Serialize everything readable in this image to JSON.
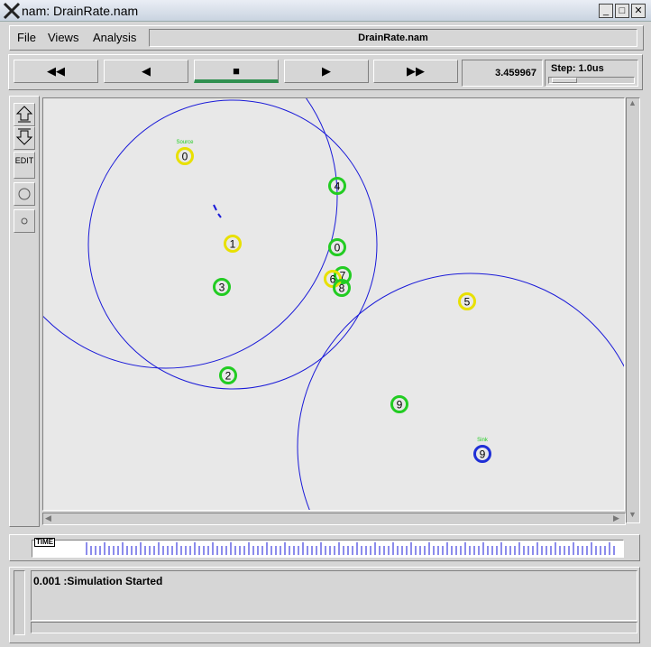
{
  "window": {
    "title": "nam: DrainRate.nam",
    "min_glyph": "_",
    "max_glyph": "□",
    "close_glyph": "✕"
  },
  "menu": {
    "file": "File",
    "views": "Views",
    "analysis": "Analysis",
    "filename": "DrainRate.nam"
  },
  "toolbar": {
    "rewind": "◀◀",
    "back": "◀",
    "stop": "■",
    "play": "▶",
    "fastforward": "▶▶",
    "time": "3.459967",
    "step": "Step: 1.0us"
  },
  "tools": {
    "edit": "EDIT"
  },
  "nodes": [
    {
      "id": "0",
      "color": "#e8e000",
      "label": "Source"
    },
    {
      "id": "1",
      "color": "#e8e000"
    },
    {
      "id": "4",
      "color": "#22cc22"
    },
    {
      "id": "0",
      "color": "#22cc22"
    },
    {
      "id": "7",
      "color": "#22cc22"
    },
    {
      "id": "6",
      "color": "#e8e000"
    },
    {
      "id": "8",
      "color": "#22cc22"
    },
    {
      "id": "3",
      "color": "#22cc22"
    },
    {
      "id": "2",
      "color": "#22cc22"
    },
    {
      "id": "5",
      "color": "#e8e000"
    },
    {
      "id": "9",
      "color": "#22cc22"
    },
    {
      "id": "9",
      "color": "#1f2fd6",
      "label": "Sink"
    }
  ],
  "timeline": {
    "label": "TIME"
  },
  "status": {
    "message": "0.001 :Simulation Started"
  },
  "colors": {
    "range_circle": "#1a1ad8",
    "label_green": "#22cc22",
    "stop_active": "#2f8f4f"
  }
}
